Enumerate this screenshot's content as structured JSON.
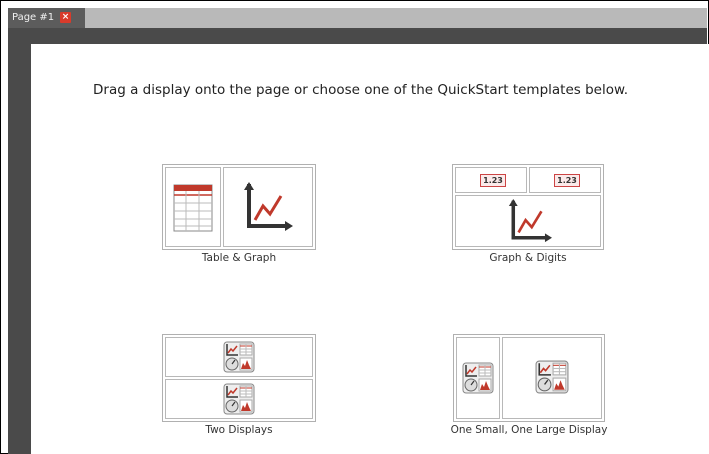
{
  "tab": {
    "title": "Page #1",
    "close_glyph": "×"
  },
  "instruction": "Drag a display onto the page or choose one of the QuickStart templates below.",
  "templates": [
    {
      "label": "Table & Graph"
    },
    {
      "label": "Graph & Digits",
      "digit_left": "1.23",
      "digit_right": "1.23"
    },
    {
      "label": "Two Displays"
    },
    {
      "label": "One Small, One Large Display"
    }
  ],
  "icons": [
    "table-icon",
    "graph-icon",
    "digits-icon",
    "multi-display-icon",
    "close-icon"
  ],
  "colors": {
    "tab_bg": "#5c5c5c",
    "tabstrip_bg": "#b9b9b9",
    "dark_panel": "#4a4a4a",
    "accent_red": "#c0392b"
  }
}
